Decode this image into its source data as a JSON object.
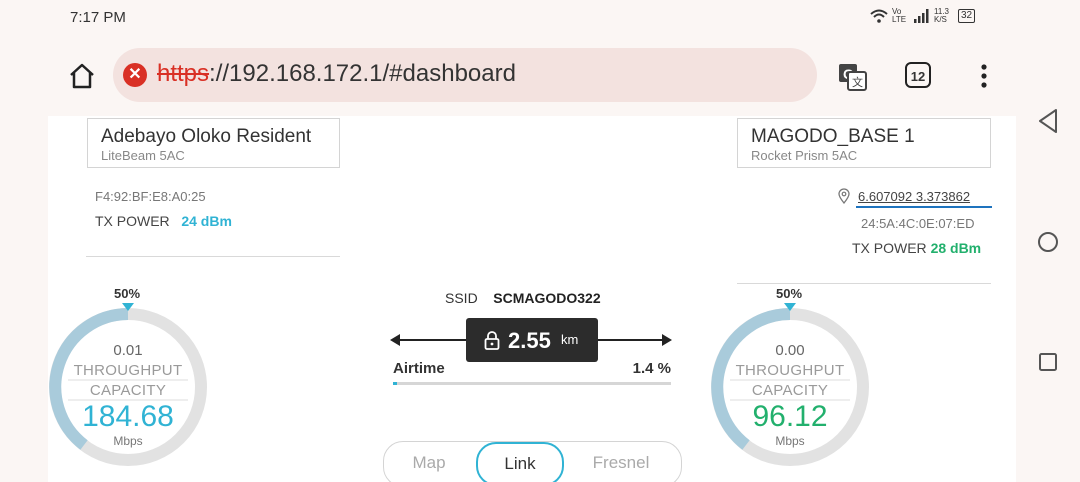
{
  "status": {
    "time": "7:17 PM",
    "net_label": "Vo LTE",
    "speed": "11.3 K/S",
    "battery": "32"
  },
  "browser": {
    "url_scheme": "https",
    "url_rest": "://192.168.172.1/#dashboard",
    "tab_count": "12"
  },
  "left": {
    "name": "Adebayo Oloko Resident",
    "model": "LiteBeam 5AC",
    "mac": "F4:92:BF:E8:A0:25",
    "tx_label": "TX POWER",
    "tx_value": "24 dBm",
    "gauge": {
      "pct": "50%",
      "throughput": "0.01",
      "l1": "THROUGHPUT",
      "l2": "CAPACITY",
      "capacity": "184.68",
      "unit": "Mbps",
      "color": "#30b3d4"
    }
  },
  "right": {
    "name": "MAGODO_BASE 1",
    "model": "Rocket Prism 5AC",
    "location": "6.607092 3.373862",
    "mac": "24:5A:4C:0E:07:ED",
    "tx_label": "TX POWER",
    "tx_value": "28 dBm",
    "gauge": {
      "pct": "50%",
      "throughput": "0.00",
      "l1": "THROUGHPUT",
      "l2": "CAPACITY",
      "capacity": "96.12",
      "unit": "Mbps",
      "color": "#22b06d"
    }
  },
  "center": {
    "ssid_label": "SSID",
    "ssid": "SCMAGODO322",
    "distance": "2.55",
    "distance_unit": "km",
    "airtime_label": "Airtime",
    "airtime_value": "1.4 %",
    "airtime_fraction": 0.014,
    "tabs": [
      "Map",
      "Link",
      "Fresnel"
    ],
    "active_tab": "Link"
  }
}
